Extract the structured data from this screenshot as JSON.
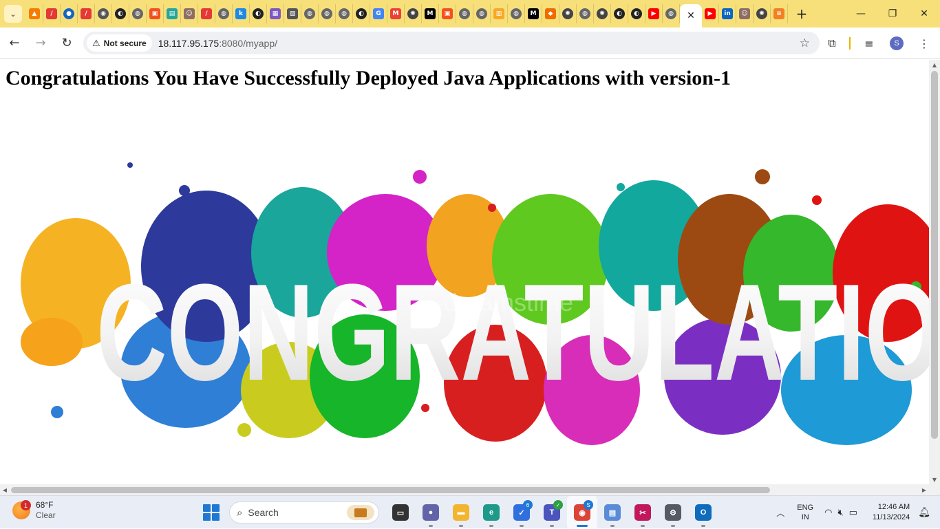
{
  "browser": {
    "tabs": [
      {
        "icon": "triangle-logo-icon",
        "color": "#f57c00",
        "glyph": "▲"
      },
      {
        "icon": "pen-icon",
        "color": "#e53935",
        "glyph": "/"
      },
      {
        "icon": "globe-icon",
        "color": "#1565c0",
        "glyph": "●"
      },
      {
        "icon": "pen-icon",
        "color": "#e53935",
        "glyph": "/"
      },
      {
        "icon": "chrome-icon",
        "color": "#555555",
        "glyph": "◉"
      },
      {
        "icon": "github-icon",
        "color": "#222222",
        "glyph": "◐"
      },
      {
        "icon": "web-icon",
        "color": "#666666",
        "glyph": "◍"
      },
      {
        "icon": "orange-app-icon",
        "color": "#f4511e",
        "glyph": "▣"
      },
      {
        "icon": "image-icon",
        "color": "#26a69a",
        "glyph": "▤"
      },
      {
        "icon": "person-icon",
        "color": "#8d6e63",
        "glyph": "☺"
      },
      {
        "icon": "pen-icon",
        "color": "#e53935",
        "glyph": "/"
      },
      {
        "icon": "web-icon",
        "color": "#666666",
        "glyph": "◍"
      },
      {
        "icon": "k-logo-icon",
        "color": "#1e88e5",
        "glyph": "k"
      },
      {
        "icon": "github-icon",
        "color": "#222222",
        "glyph": "◐"
      },
      {
        "icon": "puzzle-icon",
        "color": "#7e57c2",
        "glyph": "▦"
      },
      {
        "icon": "picture-icon",
        "color": "#555555",
        "glyph": "▧"
      },
      {
        "icon": "web-icon",
        "color": "#666666",
        "glyph": "◍"
      },
      {
        "icon": "web-icon",
        "color": "#666666",
        "glyph": "◍"
      },
      {
        "icon": "web-icon",
        "color": "#666666",
        "glyph": "◍"
      },
      {
        "icon": "github-icon",
        "color": "#222222",
        "glyph": "◐"
      },
      {
        "icon": "google-icon",
        "color": "#4285f4",
        "glyph": "G"
      },
      {
        "icon": "gmail-icon",
        "color": "#ea4335",
        "glyph": "M"
      },
      {
        "icon": "openai-icon",
        "color": "#444444",
        "glyph": "✺"
      },
      {
        "icon": "medium-icon",
        "color": "#000000",
        "glyph": "M"
      },
      {
        "icon": "orange-app-icon",
        "color": "#f4511e",
        "glyph": "▣"
      },
      {
        "icon": "web-icon",
        "color": "#666666",
        "glyph": "◍"
      },
      {
        "icon": "web-icon",
        "color": "#666666",
        "glyph": "◍"
      },
      {
        "icon": "sheet-icon",
        "color": "#f9a825",
        "glyph": "▥"
      },
      {
        "icon": "web-icon",
        "color": "#666666",
        "glyph": "◍"
      },
      {
        "icon": "medium-icon",
        "color": "#000000",
        "glyph": "M"
      },
      {
        "icon": "box-icon",
        "color": "#ef6c00",
        "glyph": "◆"
      },
      {
        "icon": "openai-icon",
        "color": "#444444",
        "glyph": "✺"
      },
      {
        "icon": "web-icon",
        "color": "#666666",
        "glyph": "◍"
      },
      {
        "icon": "openai-icon",
        "color": "#444444",
        "glyph": "✺"
      },
      {
        "icon": "github-icon",
        "color": "#222222",
        "glyph": "◐"
      },
      {
        "icon": "github-icon",
        "color": "#222222",
        "glyph": "◐"
      },
      {
        "icon": "youtube-icon",
        "color": "#ff0000",
        "glyph": "▶"
      },
      {
        "icon": "web-icon",
        "color": "#666666",
        "glyph": "◍"
      },
      {
        "icon": "active-tab",
        "color": "#ffffff",
        "glyph": ""
      },
      {
        "icon": "youtube-icon",
        "color": "#ff0000",
        "glyph": "▶"
      },
      {
        "icon": "linkedin-icon",
        "color": "#0a66c2",
        "glyph": "in"
      },
      {
        "icon": "person-icon",
        "color": "#8d6e63",
        "glyph": "☺"
      },
      {
        "icon": "openai-icon",
        "color": "#444444",
        "glyph": "✺"
      },
      {
        "icon": "stackoverflow-icon",
        "color": "#f48024",
        "glyph": "≡"
      }
    ],
    "security_label": "Not secure",
    "url_host": "18.117.95.175",
    "url_path": ":8080/myapp/",
    "profile_initial": "S"
  },
  "page": {
    "heading": "Congratulations You Have Successfully Deployed Java Applications with version-1",
    "hero_text": "CONGRATULATION",
    "watermark": "dreamstime"
  },
  "taskbar": {
    "weather_temp": "68°F",
    "weather_cond": "Clear",
    "weather_badge": "1",
    "search_label": "Search",
    "apps": [
      {
        "icon": "task-view-icon",
        "color": "#333333",
        "glyph": "▭",
        "badge": ""
      },
      {
        "icon": "teams-meet-icon",
        "color": "#6264a7",
        "glyph": "●",
        "badge": ""
      },
      {
        "icon": "file-explorer-icon",
        "color": "#f2b530",
        "glyph": "▬",
        "badge": ""
      },
      {
        "icon": "edge-icon",
        "color": "#1e9a8a",
        "glyph": "e",
        "badge": ""
      },
      {
        "icon": "todo-icon",
        "color": "#2f6fde",
        "glyph": "✓",
        "badge": "6"
      },
      {
        "icon": "teams-icon",
        "color": "#4b53bc",
        "glyph": "T",
        "badge": "✓"
      },
      {
        "icon": "chrome-icon",
        "color": "#db4437",
        "glyph": "◉",
        "badge": "S"
      },
      {
        "icon": "notepad-icon",
        "color": "#5a8bd6",
        "glyph": "▤",
        "badge": ""
      },
      {
        "icon": "snipping-tool-icon",
        "color": "#c2185b",
        "glyph": "✂",
        "badge": ""
      },
      {
        "icon": "settings-icon",
        "color": "#555a64",
        "glyph": "⚙",
        "badge": ""
      },
      {
        "icon": "outlook-icon",
        "color": "#0f6cbd",
        "glyph": "O",
        "badge": ""
      }
    ],
    "lang_top": "ENG",
    "lang_bottom": "IN",
    "time": "12:46 AM",
    "date": "11/13/2024"
  }
}
